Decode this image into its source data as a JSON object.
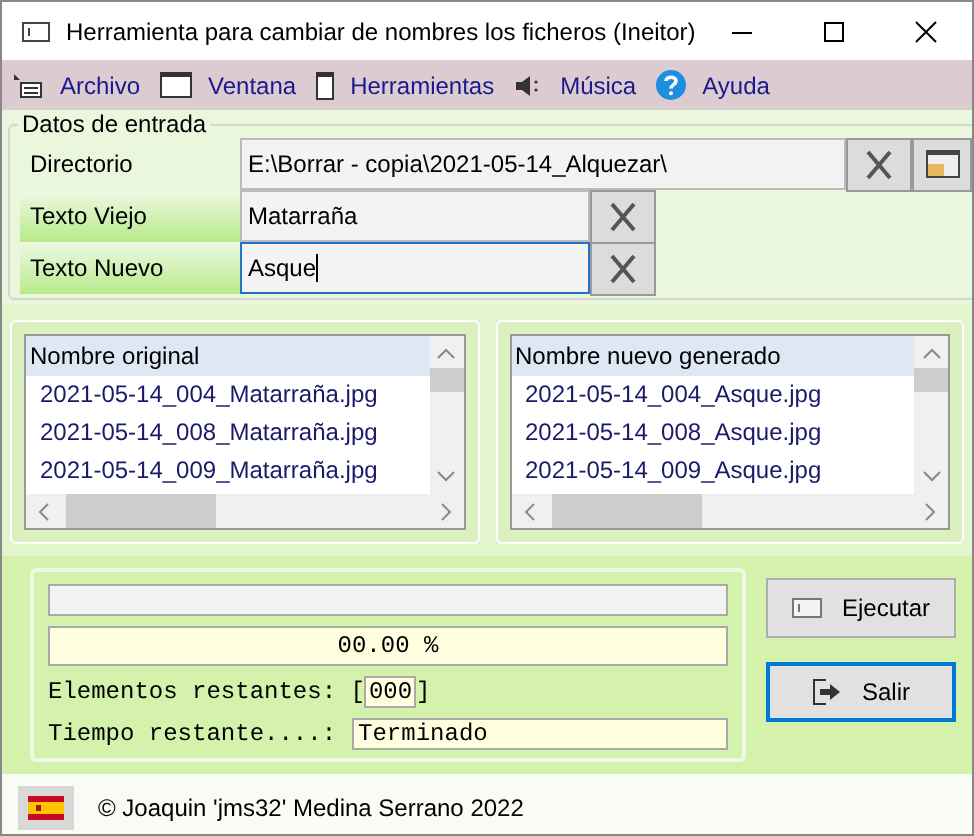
{
  "window": {
    "title": "Herramienta para cambiar de nombres los ficheros (Ineitor)"
  },
  "menu": [
    {
      "label": "Archivo",
      "kind": "file"
    },
    {
      "label": "Ventana",
      "kind": "window"
    },
    {
      "label": "Herramientas",
      "kind": "tools"
    },
    {
      "label": "Música",
      "kind": "music"
    },
    {
      "label": "Ayuda",
      "kind": "help"
    }
  ],
  "input_group": {
    "title": "Datos de entrada",
    "fields": [
      {
        "label": "Directorio",
        "value": "E:\\Borrar - copia\\2021-05-14_Alquezar\\",
        "kind": "folder",
        "focused": false
      },
      {
        "label": "Texto Viejo",
        "value": "Matarraña",
        "kind": "text",
        "focused": false
      },
      {
        "label": "Texto Nuevo",
        "value": "Asque",
        "kind": "text",
        "focused": true
      }
    ]
  },
  "lists": [
    {
      "header": "Nombre original",
      "rows": [
        "2021-05-14_004_Matarraña.jpg",
        "2021-05-14_008_Matarraña.jpg",
        "2021-05-14_009_Matarraña.jpg"
      ]
    },
    {
      "header": "Nombre nuevo generado",
      "rows": [
        "2021-05-14_004_Asque.jpg",
        "2021-05-14_008_Asque.jpg",
        "2021-05-14_009_Asque.jpg"
      ]
    }
  ],
  "progress": {
    "level": 0,
    "percent": "00.00 %",
    "remaining_label": "Elementos restantes: [",
    "remaining_value": "000",
    "remaining_close": "]",
    "time_label": "Tiempo restante....:",
    "time_value": "Terminado"
  },
  "buttons": [
    {
      "label": "Ejecutar",
      "kind": "run",
      "focused": false
    },
    {
      "label": "Salir",
      "kind": "exit",
      "focused": true
    }
  ],
  "footer": {
    "text": "© Joaquin 'jms32' Medina Serrano 2022"
  }
}
